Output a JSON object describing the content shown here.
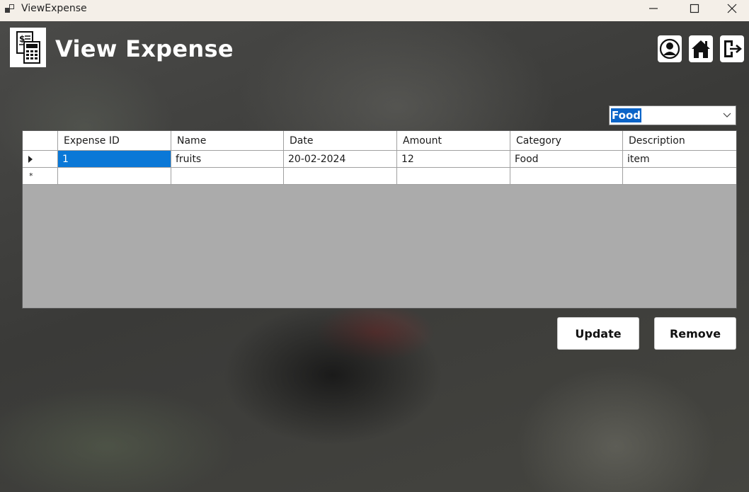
{
  "window": {
    "title": "ViewExpense",
    "controls": [
      "minimize",
      "maximize",
      "close"
    ]
  },
  "header": {
    "title": "View Expense",
    "logo_icon": "calculator-invoice-icon",
    "buttons": [
      {
        "name": "profile-button",
        "icon": "user-icon"
      },
      {
        "name": "home-button",
        "icon": "home-icon"
      },
      {
        "name": "logout-button",
        "icon": "logout-icon"
      }
    ]
  },
  "filter": {
    "selected": "Food"
  },
  "table": {
    "columns": [
      "Expense ID",
      "Name",
      "Date",
      "Amount",
      "Category",
      "Description"
    ],
    "rows": [
      [
        "1",
        "fruits",
        "20-02-2024",
        "12",
        "Food",
        "item"
      ]
    ],
    "new_row_marker": "*"
  },
  "actions": {
    "update_label": "Update",
    "remove_label": "Remove"
  },
  "colors": {
    "selection": "#0a78d7",
    "grid_empty_area": "#ababab",
    "titlebar": "#f4efe8"
  }
}
